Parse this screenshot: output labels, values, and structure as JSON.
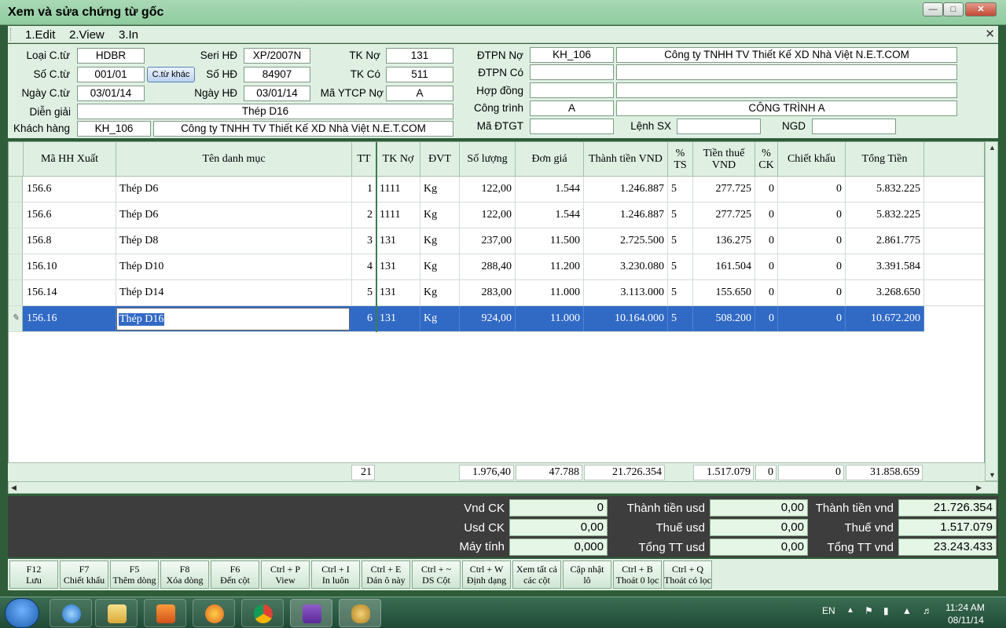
{
  "window": {
    "title": "Xem và sửa chứng từ gốc"
  },
  "menu": [
    "1.Edit",
    "2.View",
    "3.In"
  ],
  "form": {
    "loai_ctu_label": "Loại C.từ",
    "loai_ctu": "HDBR",
    "so_ctu_label": "Số C.từ",
    "so_ctu": "001/01",
    "ctu_khac_button": "C.từ khác",
    "ngay_ctu_label": "Ngày C.từ",
    "ngay_ctu": "03/01/14",
    "dien_giai_label": "Diễn giải",
    "dien_giai": "Thép D16",
    "khach_hang_label": "Khách hàng",
    "khach_hang_code": "KH_106",
    "khach_hang_name": "Công ty TNHH TV Thiết Kế  XD Nhà Việt N.E.T.COM",
    "seri_hd_label": "Seri HĐ",
    "seri_hd": "XP/2007N",
    "so_hd_label": "Số HĐ",
    "so_hd": "84907",
    "ngay_hd_label": "Ngày HĐ",
    "ngay_hd": "03/01/14",
    "tk_no_label": "TK Nợ",
    "tk_no": "131",
    "tk_co_label": "TK Có",
    "tk_co": "511",
    "ma_ytcp_label": "Mã YTCP Nợ",
    "ma_ytcp": "A",
    "dtpn_no_label": "ĐTPN Nợ",
    "dtpn_no_code": "KH_106",
    "dtpn_no_name": "Công ty TNHH TV Thiết Kế  XD Nhà Việt N.E.T.COM",
    "dtpn_co_label": "ĐTPN Có",
    "dtpn_co_code": "",
    "dtpn_co_name": "",
    "hop_dong_label": "Hợp đồng",
    "hop_dong_code": "",
    "hop_dong_name": "",
    "cong_trinh_label": "Công trình",
    "cong_trinh_code": "A",
    "cong_trinh_name": "CÔNG TRÌNH A",
    "ma_dtgt_label": "Mã ĐTGT",
    "ma_dtgt": "",
    "lenh_sx_label": "Lệnh SX",
    "lenh_sx": "",
    "ngd_label": "NGD",
    "ngd": ""
  },
  "grid": {
    "headers": [
      "Mã HH Xuất",
      "Tên danh mục",
      "TT",
      "TK Nợ",
      "ĐVT",
      "Số lượng",
      "Đơn giá",
      "Thành tiền VND",
      "% TS",
      "Tiền thuế VND",
      "% CK",
      "Chiết khấu",
      "Tổng Tiền"
    ],
    "rows": [
      [
        "156.6",
        "Thép D6",
        "1",
        "1111",
        "Kg",
        "122,00",
        "1.544",
        "1.246.887",
        "5",
        "277.725",
        "0",
        "0",
        "5.832.225"
      ],
      [
        "156.6",
        "Thép D6",
        "2",
        "1111",
        "Kg",
        "122,00",
        "1.544",
        "1.246.887",
        "5",
        "277.725",
        "0",
        "0",
        "5.832.225"
      ],
      [
        "156.8",
        "Thép D8",
        "3",
        "131",
        "Kg",
        "237,00",
        "11.500",
        "2.725.500",
        "5",
        "136.275",
        "0",
        "0",
        "2.861.775"
      ],
      [
        "156.10",
        "Thép D10",
        "4",
        "131",
        "Kg",
        "288,40",
        "11.200",
        "3.230.080",
        "5",
        "161.504",
        "0",
        "0",
        "3.391.584"
      ],
      [
        "156.14",
        "Thép D14",
        "5",
        "131",
        "Kg",
        "283,00",
        "11.000",
        "3.113.000",
        "5",
        "155.650",
        "0",
        "0",
        "3.268.650"
      ],
      [
        "156.16",
        "Thép D16",
        "6",
        "131",
        "Kg",
        "924,00",
        "11.000",
        "10.164.000",
        "5",
        "508.200",
        "0",
        "0",
        "10.672.200"
      ]
    ],
    "totals": {
      "tt": "21",
      "so_luong": "1.976,40",
      "don_gia": "47.788",
      "thanh_tien": "21.726.354",
      "tien_thue": "1.517.079",
      "pct_ck": "0",
      "chiet_khau": "0",
      "tong_tien": "31.858.659"
    }
  },
  "summary": {
    "vnd_ck_label": "Vnd CK",
    "vnd_ck": "0",
    "usd_ck_label": "Usd CK",
    "usd_ck": "0,00",
    "may_tinh_label": "Máy tính",
    "may_tinh": "0,000",
    "thanh_tien_usd_label": "Thành tiền usd",
    "thanh_tien_usd": "0,00",
    "thue_usd_label": "Thuế usd",
    "thue_usd": "0,00",
    "tong_tt_usd_label": "Tổng TT usd",
    "tong_tt_usd": "0,00",
    "thanh_tien_vnd_label": "Thành tiền vnd",
    "thanh_tien_vnd": "21.726.354",
    "thue_vnd_label": "Thuế vnd",
    "thue_vnd": "1.517.079",
    "tong_tt_vnd_label": "Tổng TT vnd",
    "tong_tt_vnd": "23.243.433"
  },
  "function_keys": [
    [
      "F12",
      "Lưu"
    ],
    [
      "F7",
      "Chiết khấu"
    ],
    [
      "F5",
      "Thêm dòng"
    ],
    [
      "F8",
      "Xóa dòng"
    ],
    [
      "F6",
      "Đến cột"
    ],
    [
      "Ctrl + P",
      "View"
    ],
    [
      "Ctrl + I",
      "In luôn"
    ],
    [
      "Ctrl + E",
      "Dán ô này"
    ],
    [
      "Ctrl + ~",
      "DS Cột"
    ],
    [
      "Ctrl + W",
      "Định dạng"
    ],
    [
      "Xem tất cả",
      "các cột"
    ],
    [
      "Cập nhật",
      "lô"
    ],
    [
      "Ctrl + B",
      "Thoát 0 lọc"
    ],
    [
      "Ctrl + Q",
      "Thoát có lọc"
    ]
  ],
  "taskbar": {
    "language": "EN",
    "time": "11:24 AM",
    "date": "08/11/14"
  },
  "icons": [
    "windows-start-icon",
    "internet-explorer-icon",
    "file-explorer-icon",
    "media-player-icon",
    "firefox-icon",
    "chrome-icon",
    "visual-studio-icon",
    "money-bag-icon"
  ]
}
